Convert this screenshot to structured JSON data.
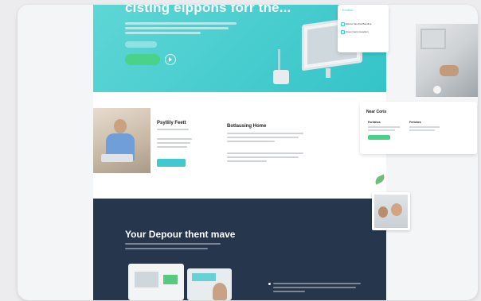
{
  "hero": {
    "title": "cisting eippons forr the...",
    "tag_label": "",
    "cta_label": "",
    "colors": {
      "start": "#5fd6d6",
      "end": "#34c4c8",
      "cta": "#4bd28a"
    }
  },
  "dropdown": {
    "header": "Evotion",
    "items": [
      "Estorw has that Baudine",
      "Crap crours treveition"
    ]
  },
  "section2": {
    "col1_title": "Psyllily Feett",
    "col2_title": "Botlausing Home",
    "button_label": ""
  },
  "right_panel": {
    "title": "Near Coris",
    "col1": "Forllahos",
    "col2": "Fertohes"
  },
  "section3": {
    "title": "Your Depour thent mave",
    "bg_color": "#26364d"
  }
}
